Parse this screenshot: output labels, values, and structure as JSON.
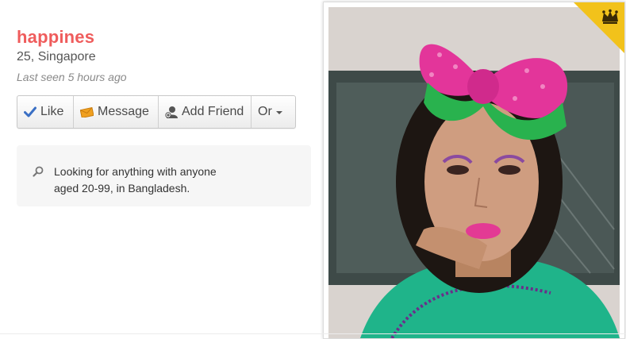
{
  "profile": {
    "username": "happines",
    "age_location": "25, Singapore",
    "last_seen": "Last seen 5 hours ago"
  },
  "actions": {
    "like": "Like",
    "message": "Message",
    "add_friend": "Add Friend",
    "or": "Or"
  },
  "looking_for": {
    "line1": "Looking for anything with anyone",
    "line2": "aged 20-99, in Bangladesh."
  },
  "icons": {
    "like": "checkmark-icon",
    "message": "envelope-icon",
    "add_friend": "person-add-icon",
    "or": "chevron-down-icon",
    "search": "search-icon",
    "badge": "crown-icon",
    "photo": "profile-photo"
  },
  "colors": {
    "username": "#ef5c5c",
    "check": "#3a6fc4",
    "envelope": "#f0a020",
    "badge": "#f2c21b"
  }
}
